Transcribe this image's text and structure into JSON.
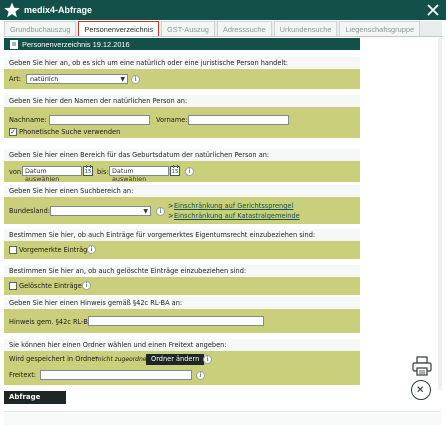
{
  "window": {
    "title": "medix4-Abfrage"
  },
  "tabs": [
    {
      "label": "Grundbuchauszug"
    },
    {
      "label": "Personenverzeichnis"
    },
    {
      "label": "GST-Auszug"
    },
    {
      "label": "Adresssuche"
    },
    {
      "label": "Urkundensuche"
    },
    {
      "label": "Liegenschaftsgruppe"
    }
  ],
  "header": {
    "title": "Personenverzeichnis 19.12.2016"
  },
  "sections": {
    "art": {
      "question": "Geben Sie hier an, ob es sich um eine natürlich oder eine juristische Person handelt:",
      "label": "Art:",
      "value": "natürlich"
    },
    "name": {
      "question": "Geben Sie hier den Namen der natürlichen Person an:",
      "nachname_label": "Nachname:",
      "nachname_value": "",
      "vorname_label": "Vorname:",
      "vorname_value": "",
      "phonetic_label": "Phonetische Suche verwenden",
      "phonetic_checked": "✓"
    },
    "birth": {
      "question": "Geben Sie hier einen Bereich für das Geburtsdatum der natürlichen Person an:",
      "from_label": "von:",
      "from_placeholder": "Datum auswählen",
      "to_label": "bis:",
      "to_placeholder": "Datum auswählen",
      "calendar_day": "15"
    },
    "region": {
      "question": "Geben Sie hier einen Suchbereich an:",
      "label": "Bundesland:",
      "value": "",
      "link_court": "Einschränkung auf Gerichtssprengel",
      "link_cadastre": "Einschränkung auf Katastralgemeinde"
    },
    "reserved": {
      "question": "Bestimmen Sie hier, ob auch Einträge für vorgemerktes Eigentumsrecht einzubeziehen sind:",
      "label": "Vorgemerkte Einträge"
    },
    "deleted": {
      "question": "Bestimmen Sie hier an, ob auch gelöschte Einträge einzubeziehen sind:",
      "label": "Gelöschte Einträge"
    },
    "hint": {
      "question": "Geben Sie hier einen Hinweis gemäß §42c RL-BA an:",
      "label": "Hinweis gem. §42c RL-BA:",
      "value": ""
    },
    "folder": {
      "question": "Sie können hier einen Ordner wählen und einen Freitext angeben:",
      "saved_label": "Wird gespeichert in Ordner",
      "folder_value": "\"nicht zugeordnet\"",
      "change_button": "Ordner ändern",
      "freetext_label": "Freitext:",
      "freetext_value": ""
    }
  },
  "footer": {
    "start_button": "Abfrage starten"
  },
  "icons": {
    "app": "star-icon",
    "close": "close-icon",
    "info": "info-icon",
    "print": "printer-icon",
    "cancel": "circle-close-icon"
  },
  "colors": {
    "titlebar": "#14504a",
    "row_background": "#c9cf7b",
    "active_tab_border": "#c0392b",
    "dark_button": "#1f2626"
  }
}
